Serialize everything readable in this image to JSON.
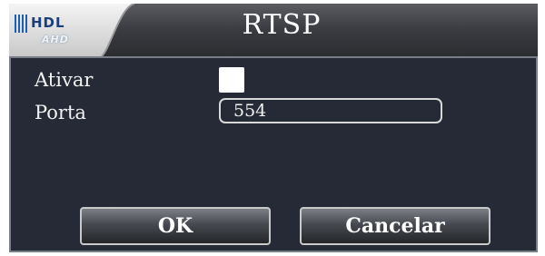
{
  "window": {
    "title": "RTSP",
    "logo": {
      "brand": "HDL",
      "sub": "AHD"
    }
  },
  "form": {
    "ativar": {
      "label": "Ativar",
      "checked": false
    },
    "porta": {
      "label": "Porta",
      "value": "554"
    }
  },
  "buttons": {
    "ok": "OK",
    "cancel": "Cancelar"
  },
  "colors": {
    "titlebar_dark": "#3b3c40",
    "tab_light": "#dcdcdc",
    "panel_bg": "#262a36",
    "logo_blue": "#1c5fb3"
  }
}
